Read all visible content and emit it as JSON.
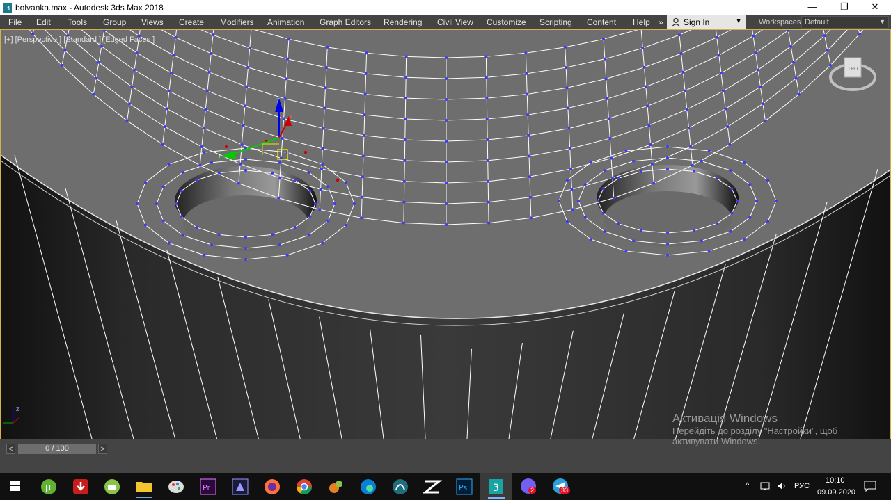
{
  "window": {
    "title": "bolvanka.max - Autodesk 3ds Max 2018",
    "minimize_glyph": "—",
    "restore_glyph": "❐",
    "close_glyph": "✕"
  },
  "menu": {
    "items": [
      "File",
      "Edit",
      "Tools",
      "Group",
      "Views",
      "Create",
      "Modifiers",
      "Animation",
      "Graph Editors",
      "Rendering",
      "Civil View",
      "Customize",
      "Scripting",
      "Content",
      "Help"
    ],
    "overflow": "»",
    "sign_in": "Sign In",
    "workspaces_label": "Workspaces:",
    "workspace_value": "Default"
  },
  "viewport": {
    "label": "[+] [Perspective ] [Standard ] [Edged Faces ]",
    "viewcube_face": "LEFT",
    "axis_labels": {
      "x": "X",
      "y": "Y",
      "z": "Z"
    }
  },
  "watermark": {
    "heading": "Активація Windows",
    "line1": "Перейдіть до розділу \"Настройки\", щоб",
    "line2": "активувати Windows."
  },
  "timeline": {
    "frame_display": "0 / 100",
    "prev": "<",
    "next": ">"
  },
  "taskbar": {
    "icons": [
      "windows-start-icon",
      "utorrent-icon",
      "download-icon",
      "android-icon",
      "file-explorer-icon",
      "paint-icon",
      "premiere-icon",
      "after-effects-icon",
      "firefox-icon",
      "chrome-icon",
      "game-icon",
      "edge-icon",
      "app-icon",
      "zbrush-icon",
      "photoshop-icon",
      "3dsmax-icon",
      "viber-icon",
      "telegram-icon"
    ],
    "viber_badge": "2",
    "telegram_badge": "33",
    "language": "РУС",
    "time": "10:10",
    "date": "09.09.2020"
  },
  "colors": {
    "menu_bg": "#444444",
    "viewport_bg": "#585858",
    "active_border": "#d2b24c",
    "vertex": "#3a3aff",
    "edge": "#ffffff",
    "gizmo_x": "#cc0000",
    "gizmo_y": "#00cc00",
    "gizmo_z": "#0000ee"
  }
}
